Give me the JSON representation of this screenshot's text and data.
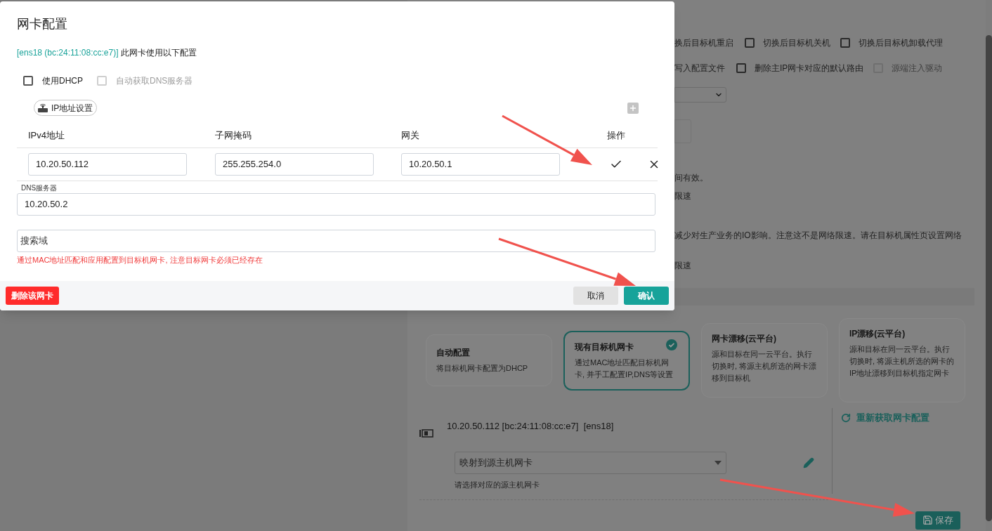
{
  "background": {
    "option_rows": [
      {
        "items": [
          {
            "kind": "label",
            "label": "换后目标机重启"
          },
          {
            "kind": "checkbox",
            "label": "切换后目标机关机",
            "checked": false,
            "disabled": false
          },
          {
            "kind": "checkbox",
            "label": "切换后目标机卸载代理",
            "checked": false,
            "disabled": false
          }
        ]
      },
      {
        "items": [
          {
            "kind": "label",
            "label": "写入配置文件"
          },
          {
            "kind": "checkbox",
            "label": "删除主IP网卡对应的默认路由",
            "checked": false,
            "disabled": false
          },
          {
            "kind": "checkbox",
            "label": "源端注入驱动",
            "checked": false,
            "disabled": true
          }
        ]
      }
    ],
    "notes": [
      "间有效。",
      "限速",
      "减少对生产业务的IO影响。注意这不是网络限速。请在目标机属性页设置网络",
      "限速"
    ],
    "nic_modes": [
      {
        "title": "自动配置",
        "description": "将目标机网卡配置为DHCP",
        "selected": false
      },
      {
        "title": "现有目标机网卡",
        "description": "通过MAC地址匹配目标机网卡, 并手工配置IP,DNS等设置",
        "selected": true
      },
      {
        "title": "网卡漂移(云平台)",
        "description": "源和目标在同一云平台。执行切换时, 将源主机所选的网卡漂移到目标机",
        "selected": false
      },
      {
        "title": "IP漂移(云平台)",
        "description": "源和目标在同一云平台。执行切换时, 将源主机所选的网卡的IP地址漂移到目标机指定网卡",
        "selected": false
      }
    ],
    "nic": {
      "summary": "10.20.50.112 [bc:24:11:08:cc:e7]  [ens18]",
      "mapping": {
        "value": "映射到源主机网卡"
      },
      "hint": "请选择对应的源主机网卡"
    },
    "refresh_link": "重新获取网卡配置",
    "save_button": "保存"
  },
  "modal": {
    "title": "网卡配置",
    "nic_label": "[ens18 (bc:24:11:08:cc:e7)]",
    "nic_suffix": "此网卡使用以下配置",
    "options": [
      {
        "label": "使用DHCP",
        "checked": false,
        "disabled": false
      },
      {
        "label": "自动获取DNS服务器",
        "checked": false,
        "disabled": true
      }
    ],
    "ip_chip": "IP地址设置",
    "table": {
      "columns": [
        "IPv4地址",
        "子网掩码",
        "网关",
        "操作"
      ],
      "rows": [
        {
          "ipv4": "10.20.50.112",
          "mask": "255.255.254.0",
          "gateway": "10.20.50.1"
        }
      ]
    },
    "dns": {
      "label": "DNS服务器",
      "value": "10.20.50.2"
    },
    "search_domain": {
      "placeholder": "搜索域"
    },
    "warning": "通过MAC地址匹配和应用配置到目标机网卡, 注意目标网卡必须已经存在",
    "buttons": {
      "delete": "删除该网卡",
      "cancel": "取消",
      "confirm": "确认"
    }
  }
}
